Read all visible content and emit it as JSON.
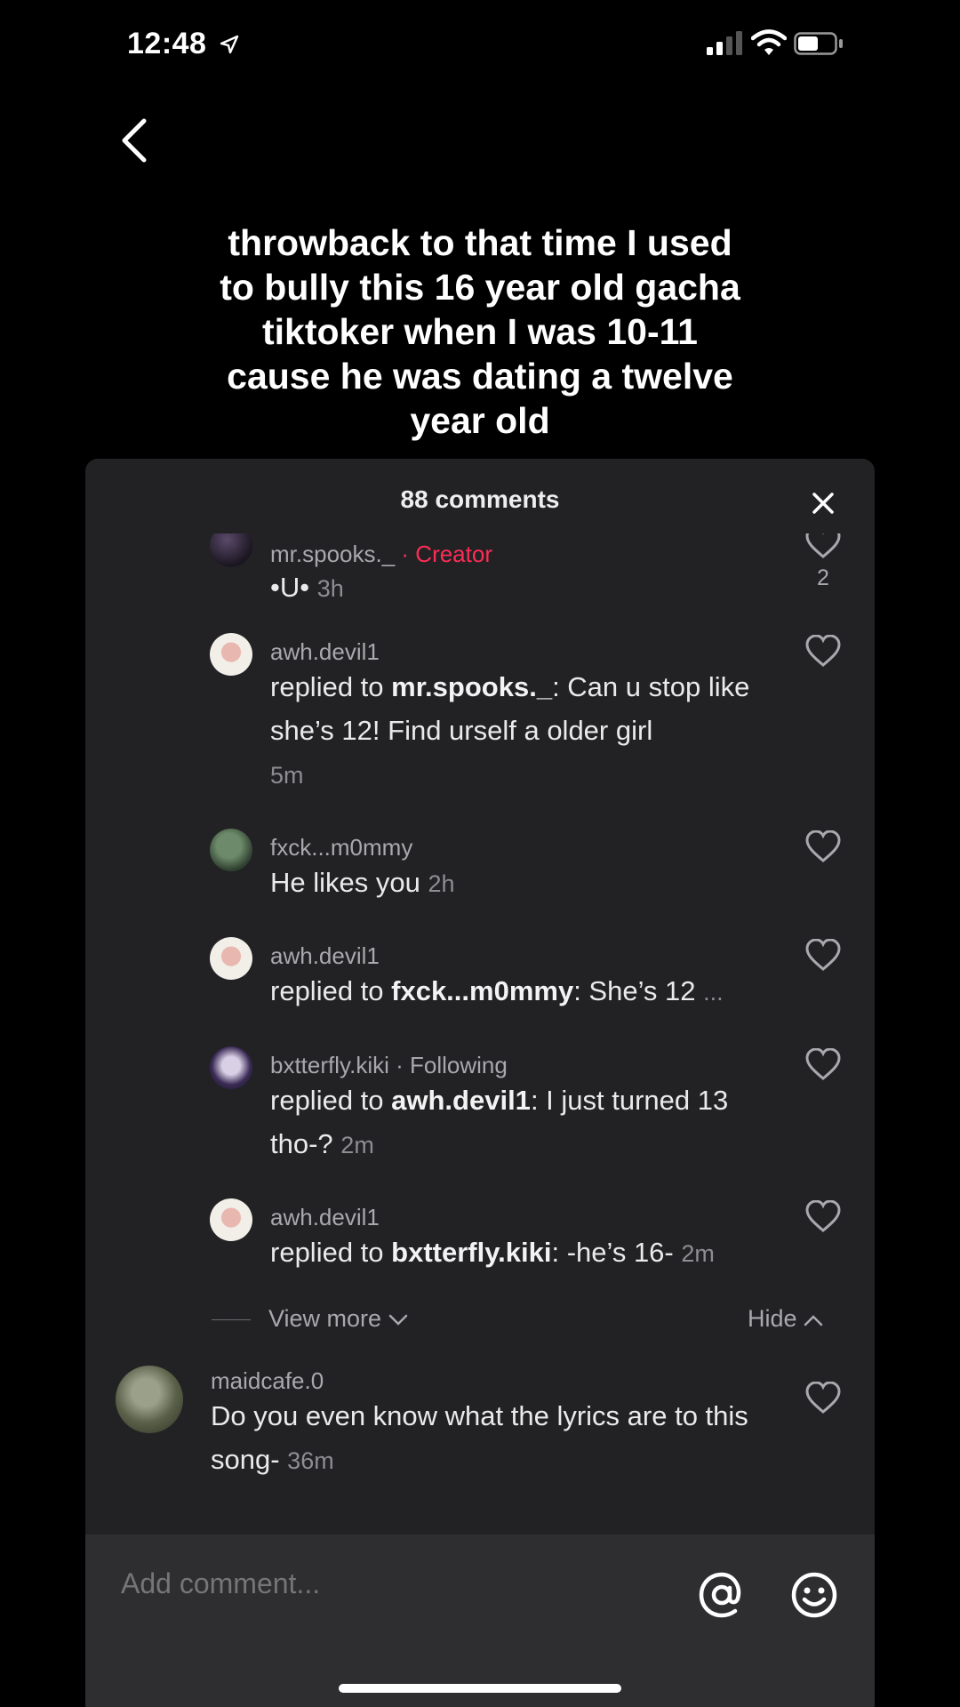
{
  "status_bar": {
    "time": "12:48"
  },
  "caption": "throwback to that time I used to bully this 16 year old gacha tiktoker when I was 10-11 cause he was dating a twelve year old",
  "sheet": {
    "title": "88 comments",
    "comments": [
      {
        "username": "mr.spooks._",
        "badge": "· Creator",
        "text": "•U•",
        "time": "3h",
        "likes": "2"
      },
      {
        "username": "awh.devil1",
        "reply_prefix": "replied to ",
        "reply_to": "mr.spooks._",
        "text": ": Can u stop like she’s 12! Find urself a older girl",
        "time": "5m"
      },
      {
        "username": "fxck...m0mmy",
        "text": "He likes you",
        "time": "2h"
      },
      {
        "username": "awh.devil1",
        "reply_prefix": "replied to ",
        "reply_to": "fxck...m0mmy",
        "text": ": She’s 12",
        "time": "..."
      },
      {
        "username": "bxtterfly.kiki",
        "badge": "· Following",
        "reply_prefix": "replied to ",
        "reply_to": "awh.devil1",
        "text": ": I just turned 13 tho-?",
        "time": "2m"
      },
      {
        "username": "awh.devil1",
        "reply_prefix": "replied to ",
        "reply_to": "bxtterfly.kiki",
        "text": ": -he’s 16-",
        "time": "2m"
      },
      {
        "username": "maidcafe.0",
        "text": "Do you even know what the lyrics are to this song-",
        "time": "36m"
      }
    ],
    "view_more": "View more",
    "hide": "Hide",
    "input_placeholder": "Add comment..."
  },
  "colors": {
    "background": "#000000",
    "sheet": "#222225",
    "accent": "#fe2c55",
    "muted": "#a9a9ad"
  },
  "icons": [
    "location-arrow-icon",
    "signal-icon",
    "wifi-icon",
    "battery-icon",
    "back-chevron-icon",
    "close-icon",
    "heart-icon",
    "chevron-down-icon",
    "chevron-up-icon",
    "at-sign-icon",
    "emoji-icon"
  ]
}
